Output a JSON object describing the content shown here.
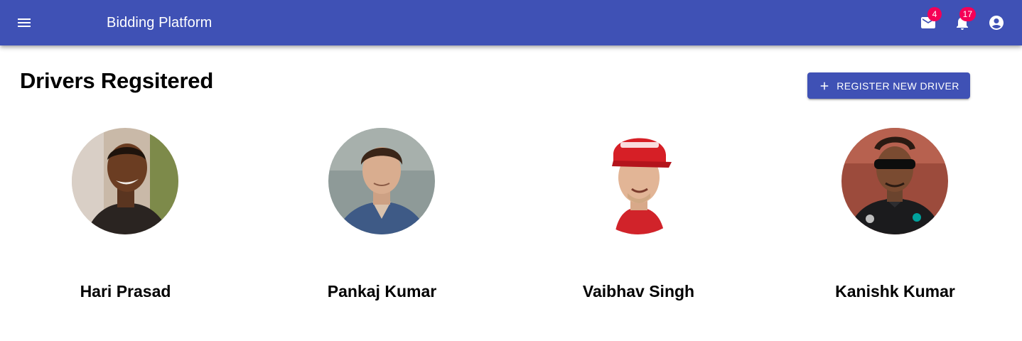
{
  "appbar": {
    "title": "Bidding Platform",
    "mail_badge": "4",
    "notifications_badge": "17",
    "color": "#3f51b5",
    "badge_color": "#f50057"
  },
  "page": {
    "title": "Drivers Regsitered",
    "register_button_label": "REGISTER NEW DRIVER"
  },
  "drivers": [
    {
      "name": "Hari Prasad"
    },
    {
      "name": "Pankaj Kumar"
    },
    {
      "name": "Vaibhav Singh"
    },
    {
      "name": "Kanishk Kumar"
    }
  ],
  "icons": {
    "menu": "menu-icon",
    "mail": "mail-icon",
    "notifications": "bell-icon",
    "account": "account-circle-icon",
    "add": "plus-icon"
  }
}
